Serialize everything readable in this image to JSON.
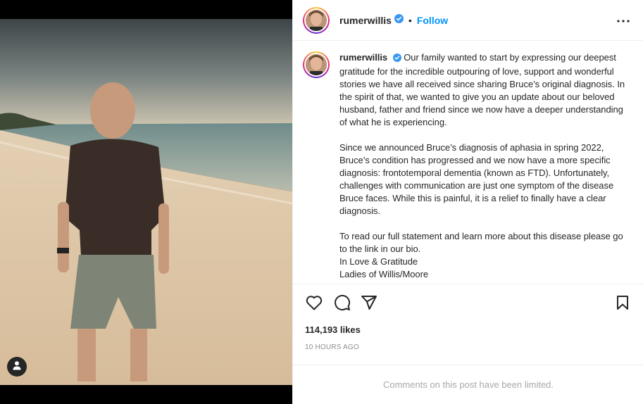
{
  "post": {
    "username": "rumerwillis",
    "follow_label": "Follow",
    "separator": "•",
    "caption_username": "rumerwillis",
    "caption_paragraphs": [
      "Our family wanted to start by expressing our deepest gratitude for the incredible outpouring of love, support and wonderful stories we have all received since sharing Bruce’s original diagnosis. In the spirit of that, we wanted to give you an update about our beloved husband, father and friend since we now have a deeper understanding of what he is experiencing.",
      "Since we announced Bruce’s diagnosis of aphasia in spring 2022, Bruce’s condition has progressed and we now have a more specific diagnosis: frontotemporal dementia (known as FTD). Unfortunately, challenges with communication are just one symptom of the disease Bruce faces. While this is painful, it is a relief to finally have a clear diagnosis.",
      "To read our full statement and learn more about this disease please go to the link in our bio."
    ],
    "closing_lines": [
      "In Love & Gratitude",
      "Ladies of Willis/Moore"
    ],
    "likes": "114,193 likes",
    "timestamp": "10 HOURS AGO",
    "comments_limited": "Comments on this post have been limited."
  },
  "icons": {
    "verified": "verified-badge-icon",
    "more": "more-options-icon",
    "like": "heart-icon",
    "comment": "comment-icon",
    "share": "paper-plane-icon",
    "save": "bookmark-icon",
    "tags": "user-tag-icon"
  },
  "colors": {
    "accent": "#0095f6",
    "verified": "#3897f0",
    "text": "#262626",
    "muted": "#8e8e8e"
  }
}
